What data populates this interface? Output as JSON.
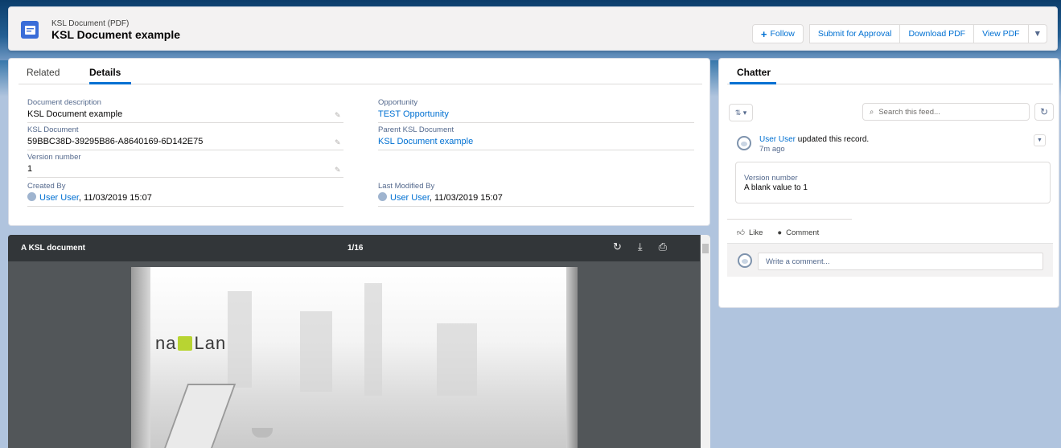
{
  "header": {
    "object_type": "KSL Document (PDF)",
    "record_title": "KSL Document example",
    "buttons": {
      "follow": "Follow",
      "submit": "Submit for Approval",
      "download": "Download PDF",
      "view": "View PDF"
    }
  },
  "details": {
    "tabs": [
      "Related",
      "Details"
    ],
    "active_tab": "Details",
    "fields": {
      "document_description": {
        "label": "Document description",
        "value": "KSL Document example"
      },
      "ksl_document": {
        "label": "KSL Document",
        "value": "59BBC38D-39295B86-A8640169-6D142E75"
      },
      "version_number": {
        "label": "Version number",
        "value": "1"
      },
      "created_by": {
        "label": "Created By",
        "user": "User User",
        "date": ", 11/03/2019 15:07"
      },
      "opportunity": {
        "label": "Opportunity",
        "value": "TEST Opportunity"
      },
      "parent_ksl_document": {
        "label": "Parent KSL Document",
        "value": "KSL Document example"
      },
      "last_modified_by": {
        "label": "Last Modified By",
        "user": "User User",
        "date": ", 11/03/2019 15:07"
      }
    }
  },
  "pdf_viewer": {
    "title": "A KSL document",
    "page_indicator": "1/16",
    "logo_left": "na",
    "logo_right": "Lan"
  },
  "chatter": {
    "tab": "Chatter",
    "search_placeholder": "Search this feed...",
    "post": {
      "author": "User User",
      "action": " updated this record.",
      "time": "7m ago",
      "change_label": "Version number",
      "change_value": "A blank value to 1"
    },
    "like": "Like",
    "comment": "Comment",
    "comment_placeholder": "Write a comment..."
  },
  "colors": {
    "brand_blue": "#0070d2",
    "object_icon": "#3a6dd8",
    "logo_accent": "#b8d432"
  }
}
